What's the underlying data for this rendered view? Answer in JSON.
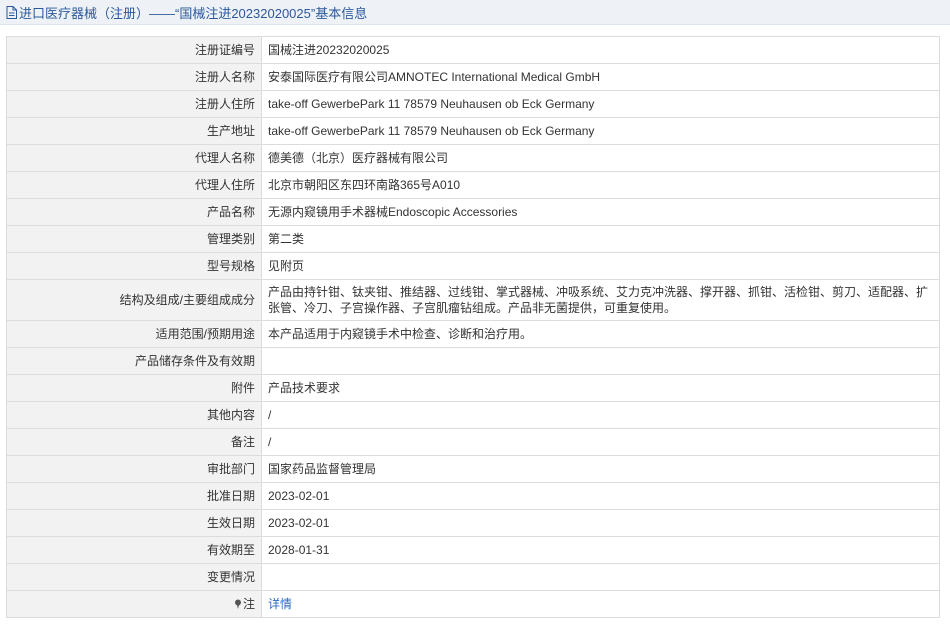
{
  "header": {
    "title": "进口医疗器械（注册）——“国械注进20232020025”基本信息"
  },
  "rows": [
    {
      "label": "注册证编号",
      "value": "国械注进20232020025"
    },
    {
      "label": "注册人名称",
      "value": "安泰国际医疗有限公司AMNOTEC International Medical GmbH"
    },
    {
      "label": "注册人住所",
      "value": "take-off GewerbePark 11 78579 Neuhausen ob Eck Germany"
    },
    {
      "label": "生产地址",
      "value": "take-off GewerbePark 11 78579 Neuhausen ob Eck Germany"
    },
    {
      "label": "代理人名称",
      "value": "德美德（北京）医疗器械有限公司"
    },
    {
      "label": "代理人住所",
      "value": "北京市朝阳区东四环南路365号A010"
    },
    {
      "label": "产品名称",
      "value": "无源内窥镜用手术器械Endoscopic Accessories"
    },
    {
      "label": "管理类别",
      "value": "第二类"
    },
    {
      "label": "型号规格",
      "value": "见附页"
    },
    {
      "label": "结构及组成/主要组成成分",
      "value": "产品由持针钳、钛夹钳、推结器、过线钳、掌式器械、冲吸系统、艾力克冲洗器、撑开器、抓钳、活检钳、剪刀、适配器、扩张管、冷刀、子宫操作器、子宫肌瘤钻组成。产品非无菌提供，可重复使用。"
    },
    {
      "label": "适用范围/预期用途",
      "value": "本产品适用于内窥镜手术中检查、诊断和治疗用。"
    },
    {
      "label": "产品储存条件及有效期",
      "value": ""
    },
    {
      "label": "附件",
      "value": "产品技术要求"
    },
    {
      "label": "其他内容",
      "value": "/"
    },
    {
      "label": "备注",
      "value": "/"
    },
    {
      "label": "审批部门",
      "value": "国家药品监督管理局"
    },
    {
      "label": "批准日期",
      "value": "2023-02-01"
    },
    {
      "label": "生效日期",
      "value": "2023-02-01"
    },
    {
      "label": "有效期至",
      "value": "2028-01-31"
    },
    {
      "label": "变更情况",
      "value": ""
    }
  ],
  "note": {
    "label": "注",
    "icon": "pin-icon",
    "link_text": "详情",
    "link_color": "#2a6cc1"
  }
}
